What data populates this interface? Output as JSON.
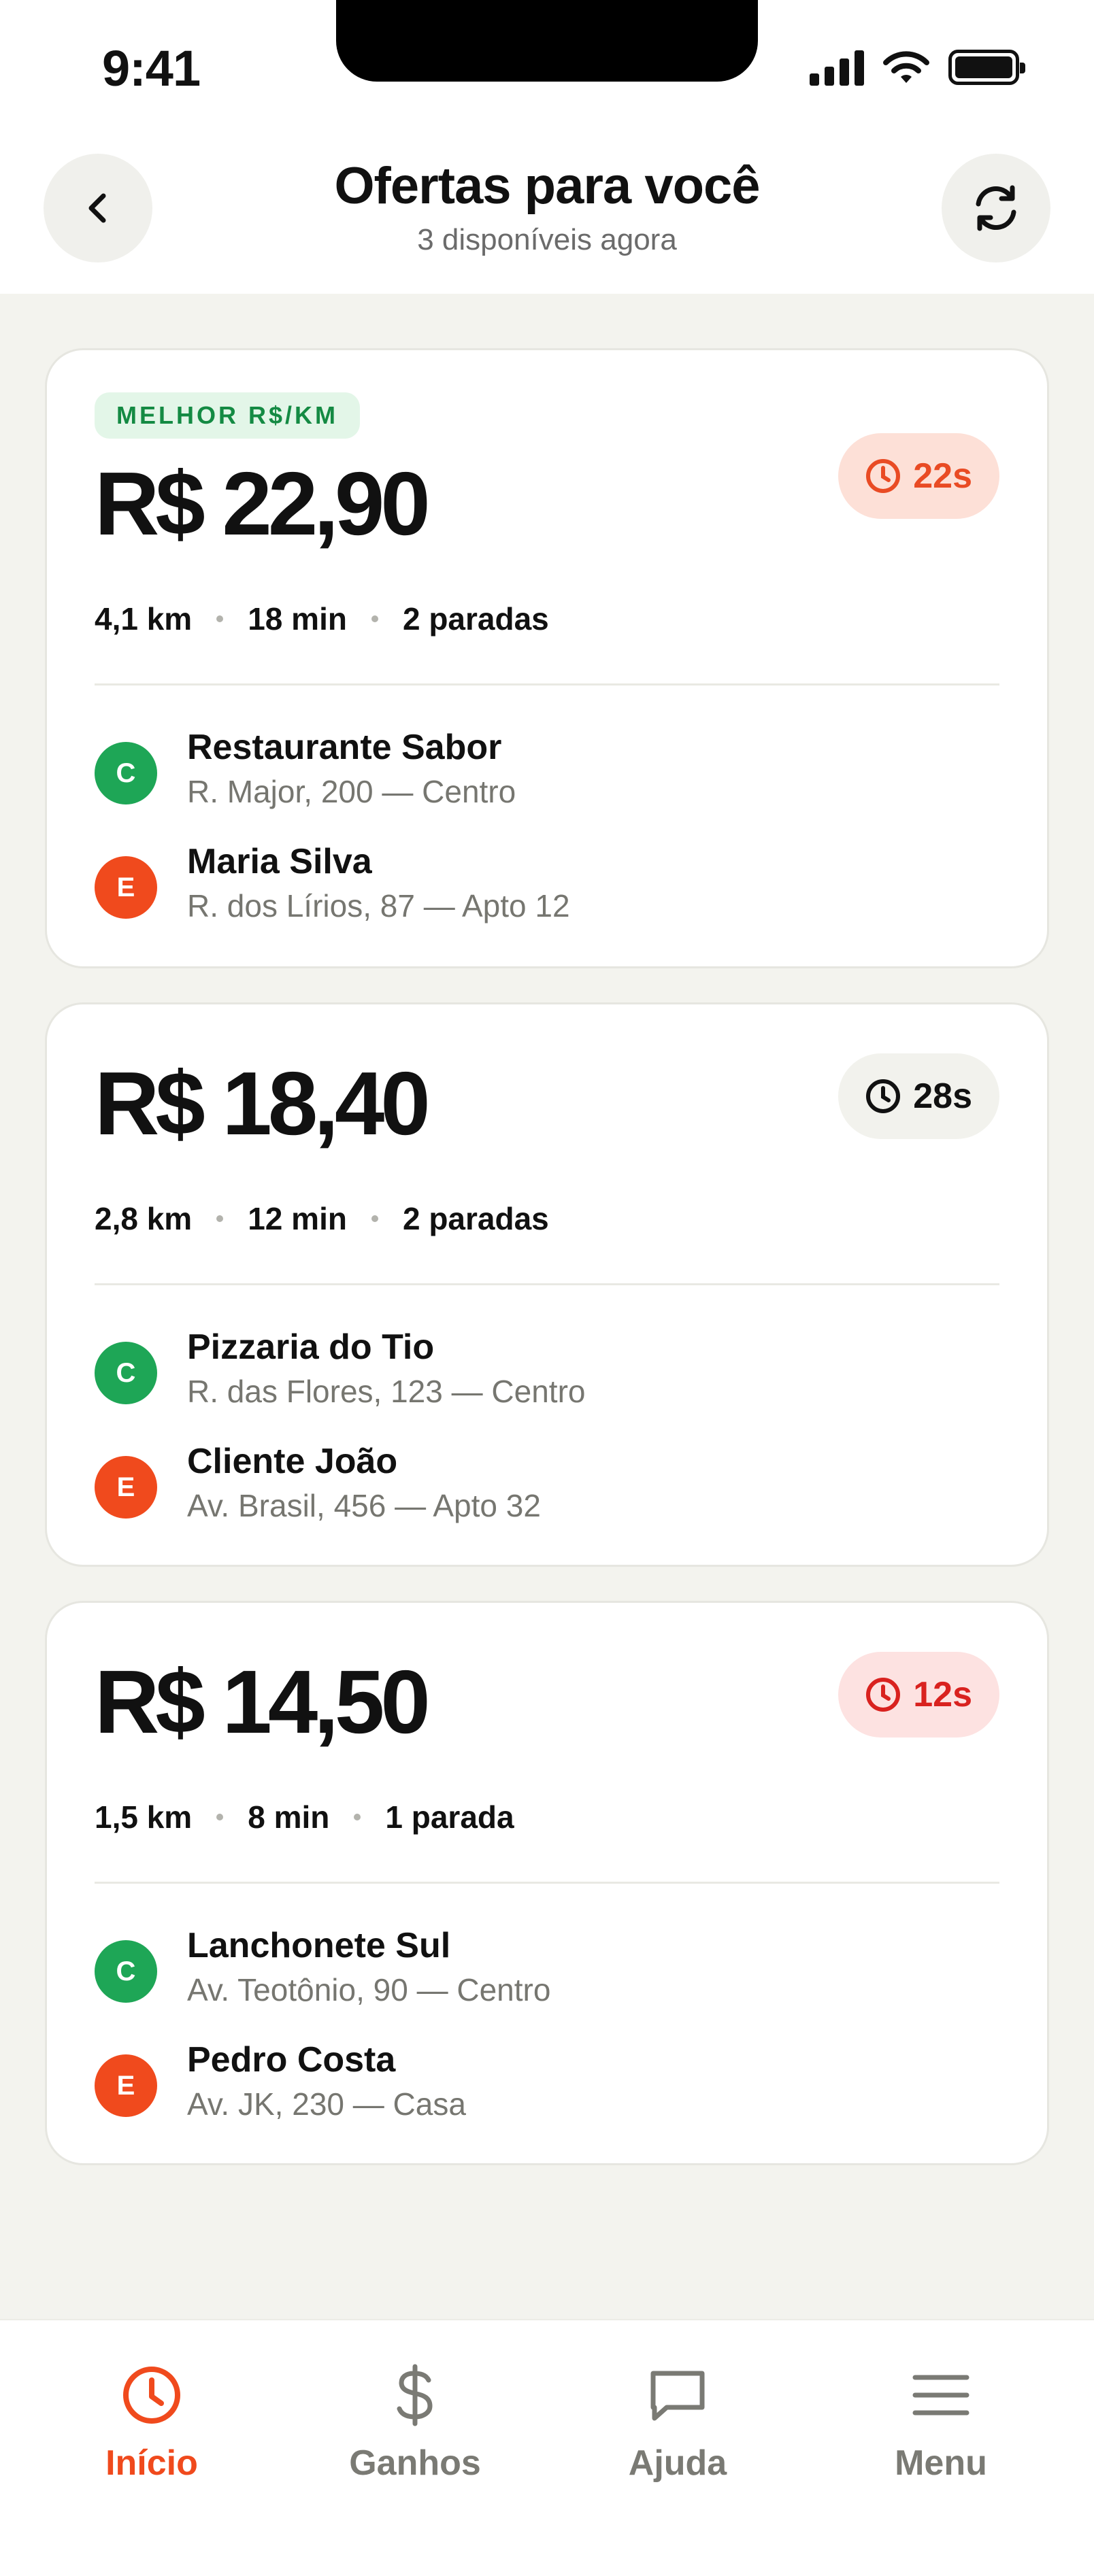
{
  "status": {
    "time": "9:41"
  },
  "header": {
    "title": "Ofertas para você",
    "subtitle": "3 disponíveis agora"
  },
  "offers": [
    {
      "badge": "MELHOR R$/KM",
      "price": "R$ 22,90",
      "timer": "22s",
      "distance": "4,1 km",
      "duration": "18 min",
      "stops": "2 paradas",
      "pickup": {
        "letter": "C",
        "name": "Restaurante Sabor",
        "address": "R. Major, 200 — Centro"
      },
      "dropoff": {
        "letter": "E",
        "name": "Maria Silva",
        "address": "R. dos Lírios, 87 — Apto 12"
      }
    },
    {
      "price": "R$ 18,40",
      "timer": "28s",
      "distance": "2,8 km",
      "duration": "12 min",
      "stops": "2 paradas",
      "pickup": {
        "letter": "C",
        "name": "Pizzaria do Tio",
        "address": "R. das Flores, 123 — Centro"
      },
      "dropoff": {
        "letter": "E",
        "name": "Cliente João",
        "address": "Av. Brasil, 456 — Apto 32"
      }
    },
    {
      "price": "R$ 14,50",
      "timer": "12s",
      "distance": "1,5 km",
      "duration": "8 min",
      "stops": "1 parada",
      "pickup": {
        "letter": "C",
        "name": "Lanchonete Sul",
        "address": "Av. Teotônio, 90 — Centro"
      },
      "dropoff": {
        "letter": "E",
        "name": "Pedro Costa",
        "address": "Av. JK, 230 — Casa"
      }
    }
  ],
  "nav": {
    "items": [
      {
        "label": "Início",
        "icon": "clock-icon",
        "active": true
      },
      {
        "label": "Ganhos",
        "icon": "dollar-icon",
        "active": false
      },
      {
        "label": "Ajuda",
        "icon": "chat-icon",
        "active": false
      },
      {
        "label": "Menu",
        "icon": "menu-icon",
        "active": false
      }
    ]
  },
  "colors": {
    "accent": "#f04a1d",
    "pickup": "#1ea656",
    "best_badge_bg": "#e3f6e8",
    "best_badge_text": "#148a43"
  }
}
